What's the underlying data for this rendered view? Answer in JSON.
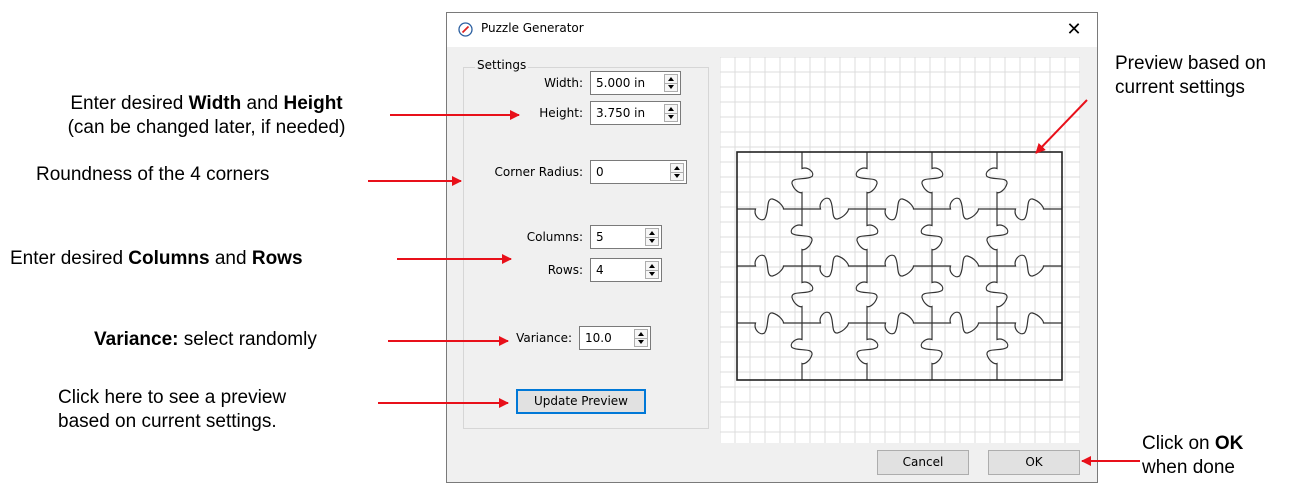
{
  "dialog": {
    "title": "Puzzle Generator",
    "close_glyph": "✕",
    "icon": "pen-nib-icon",
    "settings_group_label": "Settings",
    "fields": {
      "width": {
        "label": "Width:",
        "value": "5.000 in"
      },
      "height": {
        "label": "Height:",
        "value": "3.750 in"
      },
      "corner_radius": {
        "label": "Corner Radius:",
        "value": "0"
      },
      "columns": {
        "label": "Columns:",
        "value": "5"
      },
      "rows": {
        "label": "Rows:",
        "value": "4"
      },
      "variance": {
        "label": "Variance:",
        "value": "10.0"
      }
    },
    "update_preview_label": "Update Preview",
    "cancel_label": "Cancel",
    "ok_label": "OK",
    "preview": {
      "columns": 5,
      "rows": 4
    }
  },
  "annotations": {
    "width_height": {
      "pre": "Enter desired ",
      "b1": "Width",
      "mid": " and ",
      "b2": "Height",
      "line2": "(can be changed later, if needed)"
    },
    "corners": "Roundness of the 4 corners",
    "columns_rows": {
      "pre": "Enter desired ",
      "b1": "Columns",
      "mid": " and ",
      "b2": "Rows"
    },
    "variance": {
      "b1": "Variance:",
      "rest": " select randomly"
    },
    "update": {
      "line1": "Click here to see a preview",
      "line2": "based on current settings."
    },
    "preview": {
      "line1": "Preview based on",
      "line2": "current settings"
    },
    "ok": {
      "pre": "Click on ",
      "b1": "OK",
      "line2": "when done"
    }
  },
  "colors": {
    "arrow": "#e8101a",
    "accent": "#0078d7",
    "grid": "#dcdcdc"
  }
}
